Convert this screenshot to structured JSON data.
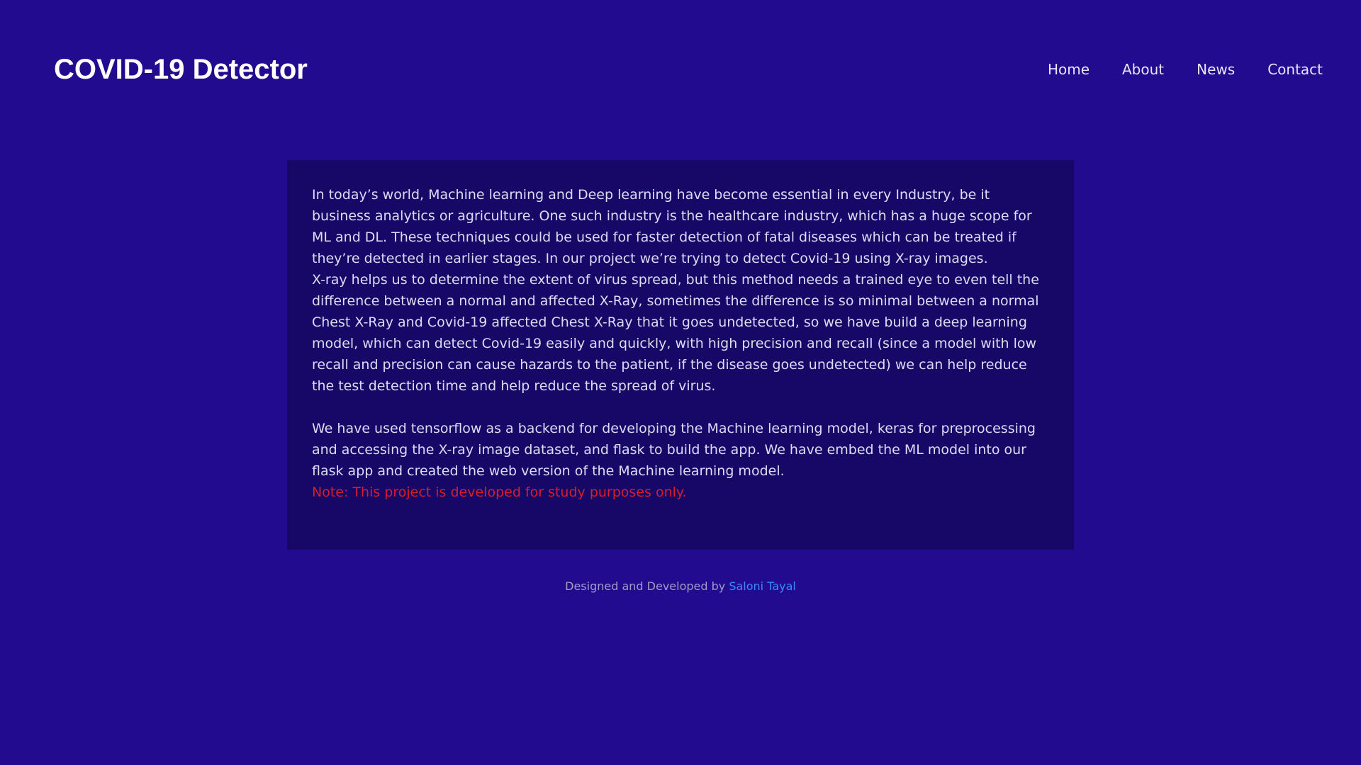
{
  "header": {
    "logo": "COVID-19 Detector",
    "nav": [
      "Home",
      "About",
      "News",
      "Contact"
    ]
  },
  "content": {
    "para1": "In today’s world, Machine learning and Deep learning have become essential in every Industry, be it business analytics or agriculture. One such industry is the healthcare industry, which has a huge scope for ML and DL. These techniques could be used for faster detection of fatal diseases which can be treated if they’re detected in earlier stages. In our project we’re trying to detect Covid-19 using X-ray images.",
    "para2": "X-ray helps us to determine the extent of virus spread, but this method needs a trained eye to even tell the difference between a normal and affected X-Ray, sometimes the difference is so minimal between a normal Chest X-Ray and Covid-19 affected Chest X-Ray that it goes undetected, so we have build a deep learning model, which can detect Covid-19 easily and quickly, with high precision and recall (since a model with low recall and precision can cause hazards to the patient, if the disease goes undetected) we can help reduce the test detection time and help reduce the spread of virus.",
    "para3": "We have used tensorflow as a backend for developing the Machine learning model, keras for preprocessing and accessing the X-ray image dataset, and flask to build the app. We have embed the ML model into our flask app and created the web version of the Machine learning model.",
    "note": "Note: This project is developed for study purposes only."
  },
  "footer": {
    "text": "Designed and Developed by ",
    "author": "Saloni Tayal"
  },
  "colors": {
    "background": "#220b8f",
    "card": "#170767",
    "note": "#d81e2a",
    "link": "#3a8bff"
  }
}
